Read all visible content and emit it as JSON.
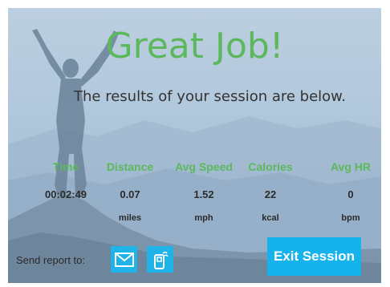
{
  "title": "Great Job!",
  "subtitle": "The results of your session are below.",
  "stats": [
    {
      "header": "Time",
      "value": "00:02:49",
      "unit": ""
    },
    {
      "header": "Distance",
      "value": "0.07",
      "unit": "miles"
    },
    {
      "header": "Avg Speed",
      "value": "1.52",
      "unit": "mph"
    },
    {
      "header": "Calories",
      "value": "22",
      "unit": "kcal"
    },
    {
      "header": "Avg HR",
      "value": "0",
      "unit": "bpm"
    }
  ],
  "send_report_label": "Send report to:",
  "icons": {
    "email": "email-icon",
    "device": "device-icon"
  },
  "exit_label": "Exit Session",
  "colors": {
    "accent_green": "#5cb85c",
    "button_blue": "#16b2ec"
  }
}
